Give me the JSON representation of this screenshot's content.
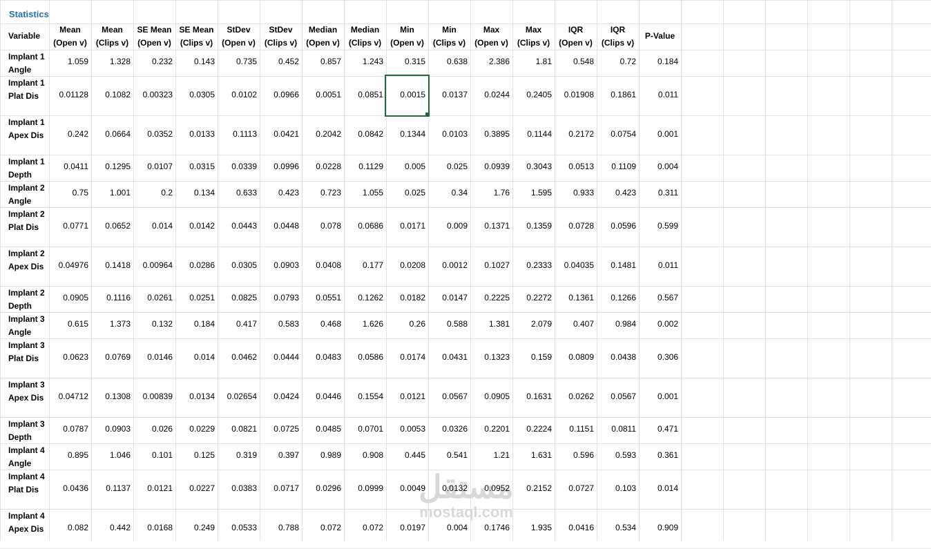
{
  "sheet": {
    "title": "Statistics",
    "variable_header": "Variable",
    "columns": [
      [
        "Mean",
        "(Open v)"
      ],
      [
        "Mean",
        "(Clips v)"
      ],
      [
        "SE Mean",
        "(Open v)"
      ],
      [
        "SE Mean",
        "(Clips v)"
      ],
      [
        "StDev",
        "(Open v)"
      ],
      [
        "StDev",
        "(Clips v)"
      ],
      [
        "Median",
        "(Open v)"
      ],
      [
        "Median",
        "(Clips v)"
      ],
      [
        "Min",
        "(Open v)"
      ],
      [
        "Min",
        "(Clips v)"
      ],
      [
        "Max",
        "(Open v)"
      ],
      [
        "Max",
        "(Clips v)"
      ],
      [
        "IQR",
        "(Open v)"
      ],
      [
        "IQR",
        "(Clips v)"
      ],
      [
        "P-Value"
      ]
    ],
    "rows": [
      {
        "label": [
          "Implant 1",
          "Angle"
        ],
        "values": [
          "1.059",
          "1.328",
          "0.232",
          "0.143",
          "0.735",
          "0.452",
          "0.857",
          "1.243",
          "0.315",
          "0.638",
          "2.386",
          "1.81",
          "0.548",
          "0.72",
          "0.184"
        ]
      },
      {
        "label": [
          "Implant 1",
          "Plat Dis"
        ],
        "values": [
          "0.01128",
          "0.1082",
          "0.00323",
          "0.0305",
          "0.0102",
          "0.0966",
          "0.0051",
          "0.0851",
          "0.0015",
          "0.0137",
          "0.0244",
          "0.2405",
          "0.01908",
          "0.1861",
          "0.011"
        ]
      },
      {
        "label": [
          "Implant 1",
          "Apex Dis"
        ],
        "values": [
          "0.242",
          "0.0664",
          "0.0352",
          "0.0133",
          "0.1113",
          "0.0421",
          "0.2042",
          "0.0842",
          "0.1344",
          "0.0103",
          "0.3895",
          "0.1144",
          "0.2172",
          "0.0754",
          "0.001"
        ]
      },
      {
        "label": [
          "Implant 1",
          "Depth"
        ],
        "values": [
          "0.0411",
          "0.1295",
          "0.0107",
          "0.0315",
          "0.0339",
          "0.0996",
          "0.0228",
          "0.1129",
          "0.005",
          "0.025",
          "0.0939",
          "0.3043",
          "0.0513",
          "0.1109",
          "0.004"
        ]
      },
      {
        "label": [
          "Implant 2",
          "Angle"
        ],
        "values": [
          "0.75",
          "1.001",
          "0.2",
          "0.134",
          "0.633",
          "0.423",
          "0.723",
          "1.055",
          "0.025",
          "0.34",
          "1.76",
          "1.595",
          "0.933",
          "0.423",
          "0.311"
        ]
      },
      {
        "label": [
          "Implant 2",
          "Plat Dis"
        ],
        "values": [
          "0.0771",
          "0.0652",
          "0.014",
          "0.0142",
          "0.0443",
          "0.0448",
          "0.078",
          "0.0686",
          "0.0171",
          "0.009",
          "0.1371",
          "0.1359",
          "0.0728",
          "0.0596",
          "0.599"
        ]
      },
      {
        "label": [
          "Implant 2",
          "Apex Dis"
        ],
        "values": [
          "0.04976",
          "0.1418",
          "0.00964",
          "0.0286",
          "0.0305",
          "0.0903",
          "0.0408",
          "0.177",
          "0.0208",
          "0.0012",
          "0.1027",
          "0.2333",
          "0.04035",
          "0.1481",
          "0.011"
        ]
      },
      {
        "label": [
          "Implant 2",
          "Depth"
        ],
        "values": [
          "0.0905",
          "0.1116",
          "0.0261",
          "0.0251",
          "0.0825",
          "0.0793",
          "0.0551",
          "0.1262",
          "0.0182",
          "0.0147",
          "0.2225",
          "0.2272",
          "0.1361",
          "0.1266",
          "0.567"
        ]
      },
      {
        "label": [
          "Implant 3",
          "Angle"
        ],
        "values": [
          "0.615",
          "1.373",
          "0.132",
          "0.184",
          "0.417",
          "0.583",
          "0.468",
          "1.626",
          "0.26",
          "0.588",
          "1.381",
          "2.079",
          "0.407",
          "0.984",
          "0.002"
        ]
      },
      {
        "label": [
          "Implant 3",
          "Plat Dis"
        ],
        "values": [
          "0.0623",
          "0.0769",
          "0.0146",
          "0.014",
          "0.0462",
          "0.0444",
          "0.0483",
          "0.0586",
          "0.0174",
          "0.0431",
          "0.1323",
          "0.159",
          "0.0809",
          "0.0438",
          "0.306"
        ]
      },
      {
        "label": [
          "Implant 3",
          "Apex Dis"
        ],
        "values": [
          "0.04712",
          "0.1308",
          "0.00839",
          "0.0134",
          "0.02654",
          "0.0424",
          "0.0446",
          "0.1554",
          "0.0121",
          "0.0567",
          "0.0905",
          "0.1631",
          "0.0262",
          "0.0567",
          "0.001"
        ]
      },
      {
        "label": [
          "Implant 3",
          "Depth"
        ],
        "values": [
          "0.0787",
          "0.0903",
          "0.026",
          "0.0229",
          "0.0821",
          "0.0725",
          "0.0485",
          "0.0701",
          "0.0053",
          "0.0326",
          "0.2201",
          "0.2224",
          "0.1151",
          "0.0811",
          "0.471"
        ]
      },
      {
        "label": [
          "Implant 4",
          "Angle"
        ],
        "values": [
          "0.895",
          "1.046",
          "0.101",
          "0.125",
          "0.319",
          "0.397",
          "0.989",
          "0.908",
          "0.445",
          "0.541",
          "1.21",
          "1.631",
          "0.596",
          "0.593",
          "0.361"
        ]
      },
      {
        "label": [
          "Implant 4",
          "Plat Dis"
        ],
        "values": [
          "0.0436",
          "0.1137",
          "0.0121",
          "0.0227",
          "0.0383",
          "0.0717",
          "0.0296",
          "0.0999",
          "0.0049",
          "0.0132",
          "0.0952",
          "0.2152",
          "0.0727",
          "0.103",
          "0.014"
        ]
      },
      {
        "label": [
          "Implant 4",
          "Apex Dis"
        ],
        "values": [
          "0.082",
          "0.442",
          "0.0168",
          "0.249",
          "0.0533",
          "0.788",
          "0.072",
          "0.072",
          "0.0197",
          "0.004",
          "0.1746",
          "1.935",
          "0.0416",
          "0.534",
          "0.909"
        ]
      }
    ]
  },
  "watermark": {
    "arabic": "مستقل",
    "latin": "mostaql.com"
  }
}
